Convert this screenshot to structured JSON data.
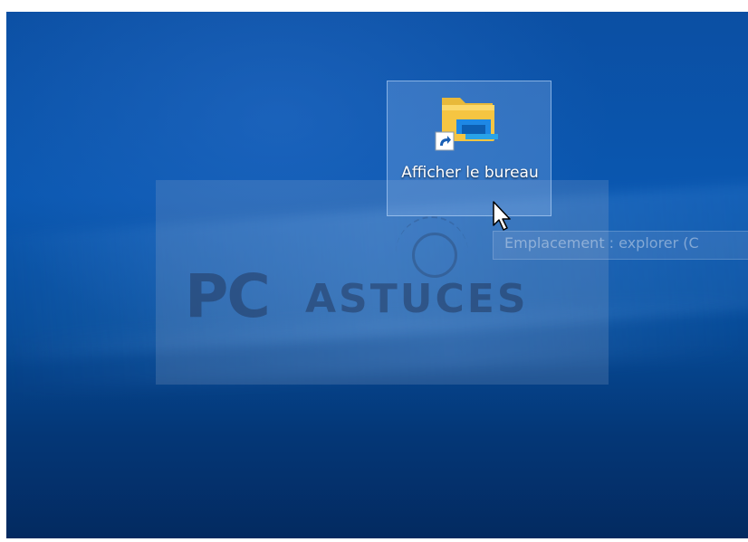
{
  "desktop": {
    "shortcut": {
      "label": "Afficher le bureau",
      "icon": "file-explorer-folder-icon",
      "badge_icon": "shortcut-arrow-icon"
    },
    "tooltip": {
      "text": "Emplacement : explorer (C"
    },
    "watermark": {
      "brand_pc": "PC",
      "brand_astuces": "ASTUCES",
      "icon": "lightbulb-icon"
    },
    "cursor": "mouse-pointer-icon"
  },
  "colors": {
    "wallpaper_top": "#0b4fa3",
    "wallpaper_bottom": "#032a60",
    "folder_yellow": "#f5c542",
    "folder_blue": "#1e88e5"
  }
}
